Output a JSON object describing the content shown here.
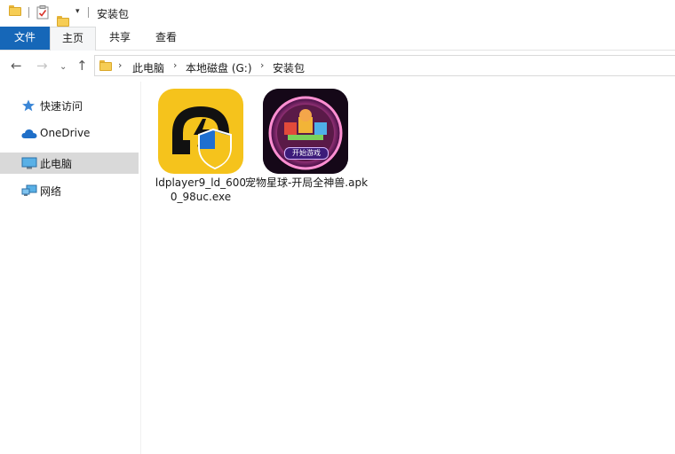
{
  "window": {
    "title": "安装包"
  },
  "quick_access_toolbar": {
    "icons": [
      "folder-icon",
      "properties-icon",
      "new-folder-icon",
      "customize-dropdown-icon"
    ]
  },
  "ribbon": {
    "tabs": [
      {
        "label": "文件",
        "type": "file"
      },
      {
        "label": "主页",
        "active": true
      },
      {
        "label": "共享"
      },
      {
        "label": "查看"
      }
    ]
  },
  "address_bar": {
    "breadcrumbs": [
      "此电脑",
      "本地磁盘 (G:)",
      "安装包"
    ]
  },
  "sidebar": {
    "items": [
      {
        "label": "快速访问",
        "icon": "star-icon"
      },
      {
        "label": "OneDrive",
        "icon": "cloud-icon"
      },
      {
        "label": "此电脑",
        "icon": "monitor-icon",
        "selected": true
      },
      {
        "label": "网络",
        "icon": "network-icon"
      }
    ]
  },
  "files": [
    {
      "name": "ldplayer9_ld_6000_98uc.exe",
      "icon": "ldplayer-app-icon"
    },
    {
      "name": "宠物星球-开局全神兽.apk",
      "icon": "game-app-icon",
      "banner_text": "开始游戏"
    }
  ],
  "colors": {
    "accent": "#1667b8",
    "selected_bg": "#d9d9d9",
    "folder": "#f6cd55"
  }
}
